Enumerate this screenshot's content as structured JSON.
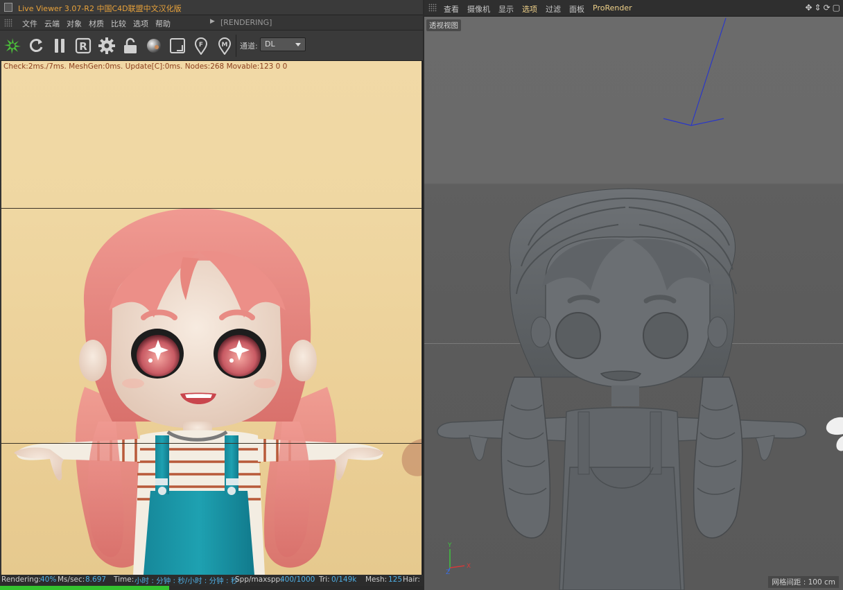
{
  "live_viewer": {
    "title": "Live Viewer 3.07-R2 中国C4D联盟中文汉化版",
    "menu": [
      "文件",
      "云端",
      "对象",
      "材质",
      "比较",
      "选项",
      "帮助"
    ],
    "render_state": "[RENDERING]",
    "toolbar": {
      "icons": [
        "octane-logo-icon",
        "refresh-icon",
        "pause-icon",
        "r-icon",
        "gear-icon",
        "lock-icon",
        "material-ball-icon",
        "region-render-icon",
        "focus-pick-icon",
        "material-pick-icon"
      ],
      "channel_label": "通道:",
      "channel_value": "DL"
    },
    "stats_line": "Check:2ms./7ms. MeshGen:0ms. Update[C]:0ms. Nodes:268 Movable:123  0 0",
    "status": {
      "rendering_label": "Rendering:",
      "rendering_value": "40%",
      "ms_label": "Ms/sec:",
      "ms_value": "8.697",
      "time_label": "Time:",
      "time_value": "小时 : 分钟 : 秒/小时 : 分钟 : 秒",
      "spp_label": "Spp/maxspp:",
      "spp_value": "400/1000",
      "tri_label": "Tri:",
      "tri_value": "0/149k",
      "mesh_label": "Mesh:",
      "mesh_value": "125",
      "hair_label": "Hair:"
    },
    "progress": 0.4,
    "colors": {
      "title": "#e8a23a",
      "stats": "#8a3d1c",
      "status_value": "#4fb0e6",
      "progress": "#34c22f"
    }
  },
  "viewport": {
    "menu": [
      "查看",
      "摄像机",
      "显示",
      "选项",
      "过滤",
      "面板",
      "ProRender"
    ],
    "active_menu": "选项",
    "nav_icons": [
      "move-icon",
      "dolly-icon",
      "rotate-icon",
      "maximize-icon"
    ],
    "view_label": "透视视图",
    "grid_spacing": "网格间距 : 100 cm",
    "axes": {
      "y": "Y",
      "x": "X",
      "z": "Z"
    }
  }
}
